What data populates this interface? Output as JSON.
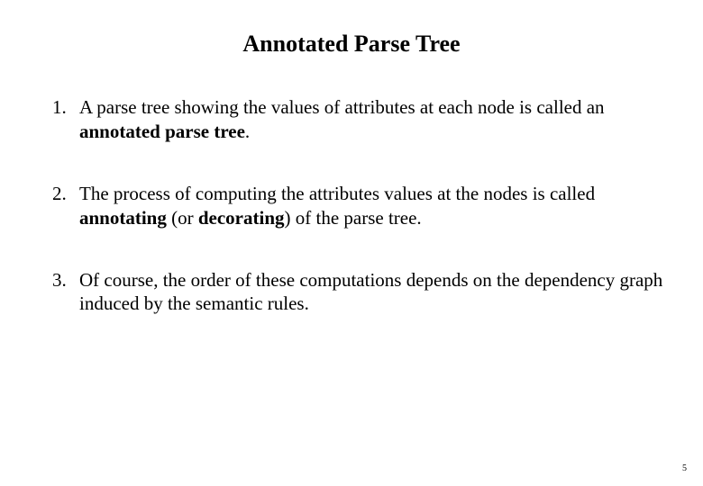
{
  "title": "Annotated Parse Tree",
  "items": [
    {
      "num": "1.",
      "pre": "A parse tree showing the values of attributes at each node is called an ",
      "bold": "annotated parse tree",
      "post": "."
    },
    {
      "num": "2.",
      "pre": "The process of computing the attributes values at the nodes is called ",
      "bold": "annotating",
      "mid": " (or ",
      "bold2": "decorating",
      "post": ") of the parse tree."
    },
    {
      "num": "3.",
      "pre": "Of course, the order of these computations depends on the dependency graph induced by the semantic rules.",
      "bold": "",
      "post": ""
    }
  ],
  "page_number": "5"
}
